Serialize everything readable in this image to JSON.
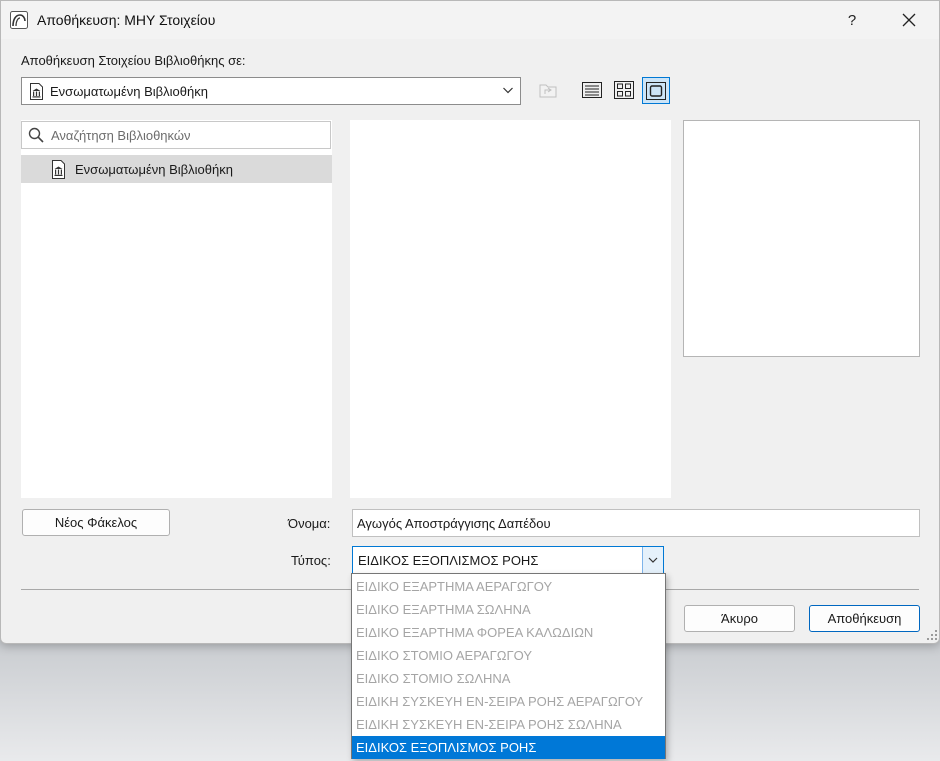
{
  "window": {
    "title": "Αποθήκευση: ΜΗΥ Στοιχείου",
    "help_label": "?"
  },
  "location": {
    "label": "Αποθήκευση Στοιχείου Βιβλιοθήκης σε:",
    "selected": "Ενσωματωμένη Βιβλιοθήκη"
  },
  "search": {
    "placeholder": "Αναζήτηση Βιβλιοθηκών"
  },
  "libraries": [
    {
      "label": "Ενσωματωμένη Βιβλιοθήκη",
      "selected": true
    }
  ],
  "buttons": {
    "new_folder": "Νέος Φάκελος",
    "cancel": "Άκυρο",
    "save": "Αποθήκευση"
  },
  "name": {
    "label": "Όνομα:",
    "value": "Αγωγός Αποστράγγισης Δαπέδου"
  },
  "type": {
    "label": "Τύπος:",
    "value": "ΕΙΔΙΚΟΣ ΕΞΟΠΛΙΣΜΟΣ ΡΟΗΣ",
    "options": [
      "ΕΙΔΙΚΟ ΕΞΑΡΤΗΜΑ ΑΕΡΑΓΩΓΟΥ",
      "ΕΙΔΙΚΟ ΕΞΑΡΤΗΜΑ ΣΩΛΗΝΑ",
      "ΕΙΔΙΚΟ ΕΞΑΡΤΗΜΑ ΦΟΡΕΑ ΚΑΛΩΔΙΩΝ",
      "ΕΙΔΙΚΟ ΣΤΟΜΙΟ ΑΕΡΑΓΩΓΟΥ",
      "ΕΙΔΙΚΟ ΣΤΟΜΙΟ ΣΩΛΗΝΑ",
      "ΕΙΔΙΚΗ ΣΥΣΚΕΥΗ ΕΝ-ΣΕΙΡΑ ΡΟΗΣ ΑΕΡΑΓΩΓΟΥ",
      "ΕΙΔΙΚΗ ΣΥΣΚΕΥΗ ΕΝ-ΣΕΙΡΑ ΡΟΗΣ ΣΩΛΗΝΑ",
      "ΕΙΔΙΚΟΣ ΕΞΟΠΛΙΣΜΟΣ ΡΟΗΣ"
    ],
    "selected_index": 7
  },
  "icons": {
    "app": "archicad-icon",
    "library": "library-icon",
    "search": "search-icon",
    "up_folder": "folder-up-icon",
    "list_view": "list-view-icon",
    "grid_view": "grid-view-icon",
    "preview_view": "preview-view-icon"
  },
  "colors": {
    "accent": "#0078d7",
    "selection_bg": "#dadada"
  }
}
